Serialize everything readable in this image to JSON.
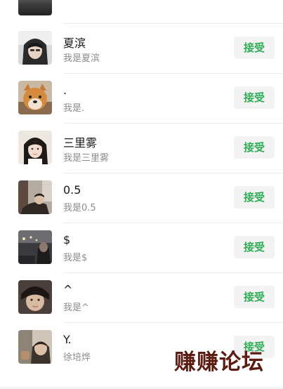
{
  "requests": [
    {
      "name": "夏滨",
      "message": "我是夏滨",
      "accept_label": "接受",
      "avatar": "avatar-girl-hood"
    },
    {
      "name": ".",
      "message": "我是.",
      "accept_label": "接受",
      "avatar": "avatar-shiba-dog"
    },
    {
      "name": "三里雾",
      "message": "我是三里雾",
      "accept_label": "接受",
      "avatar": "avatar-girl-portrait"
    },
    {
      "name": "0.5",
      "message": "我是0.5",
      "accept_label": "接受",
      "avatar": "avatar-man-lying"
    },
    {
      "name": "$",
      "message": "我是$",
      "accept_label": "接受",
      "avatar": "avatar-night-street"
    },
    {
      "name": "^",
      "message": "我是^",
      "accept_label": "接受",
      "avatar": "avatar-boy-closeup"
    },
    {
      "name": "Y.",
      "message": "徐培烨",
      "accept_label": "接受",
      "avatar": "avatar-man-window"
    }
  ],
  "watermark": "赚赚论坛",
  "colors": {
    "accept_text": "#2fad55",
    "accept_bg": "#f3f3f3",
    "name_text": "#1a1a1a",
    "message_text": "#8c8c8c",
    "watermark": "#5b1d13"
  }
}
